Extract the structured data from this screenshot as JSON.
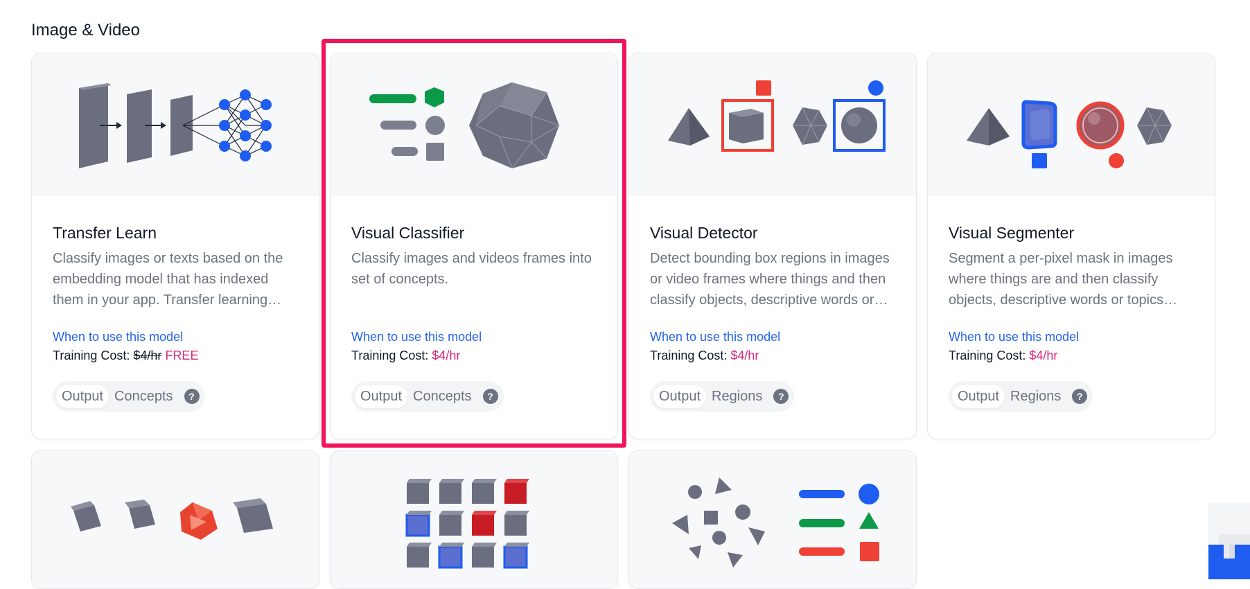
{
  "section": {
    "title": "Image & Video"
  },
  "cards": [
    {
      "title": "Transfer Learn",
      "description": "Classify images or texts based on the embedding model that has indexed them in your app. Transfer learning leverages feature representations from a pre-trained model.",
      "when_link": "When to use this model",
      "cost_label": "Training Cost:",
      "cost_strike": "$4/hr",
      "cost_value": "FREE",
      "pill": {
        "output": "Output",
        "type": "Concepts",
        "help": "?"
      }
    },
    {
      "title": "Visual Classifier",
      "description": "Classify images and videos frames into set of concepts.",
      "when_link": "When to use this model",
      "cost_label": "Training Cost:",
      "cost_value": "$4/hr",
      "pill": {
        "output": "Output",
        "type": "Concepts",
        "help": "?"
      }
    },
    {
      "title": "Visual Detector",
      "description": "Detect bounding box regions in images or video frames where things and then classify objects, descriptive words or topics within the boxes.",
      "when_link": "When to use this model",
      "cost_label": "Training Cost:",
      "cost_value": "$4/hr",
      "pill": {
        "output": "Output",
        "type": "Regions",
        "help": "?"
      }
    },
    {
      "title": "Visual Segmenter",
      "description": "Segment a per-pixel mask in images where things are and then classify objects, descriptive words or topics within the masks.",
      "when_link": "When to use this model",
      "cost_label": "Training Cost:",
      "cost_value": "$4/hr",
      "pill": {
        "output": "Output",
        "type": "Regions",
        "help": "?"
      }
    }
  ],
  "colors": {
    "accent": "#2563eb",
    "price": "#db2777",
    "highlight": "#f0145a",
    "shape": "#6b6e7e"
  },
  "icons": [
    "neural-network-icon",
    "classifier-shapes-icon",
    "detector-boxes-icon",
    "segmenter-masks-icon",
    "clustering-icon",
    "embedding-grid-icon",
    "scatter-shapes-icon"
  ]
}
